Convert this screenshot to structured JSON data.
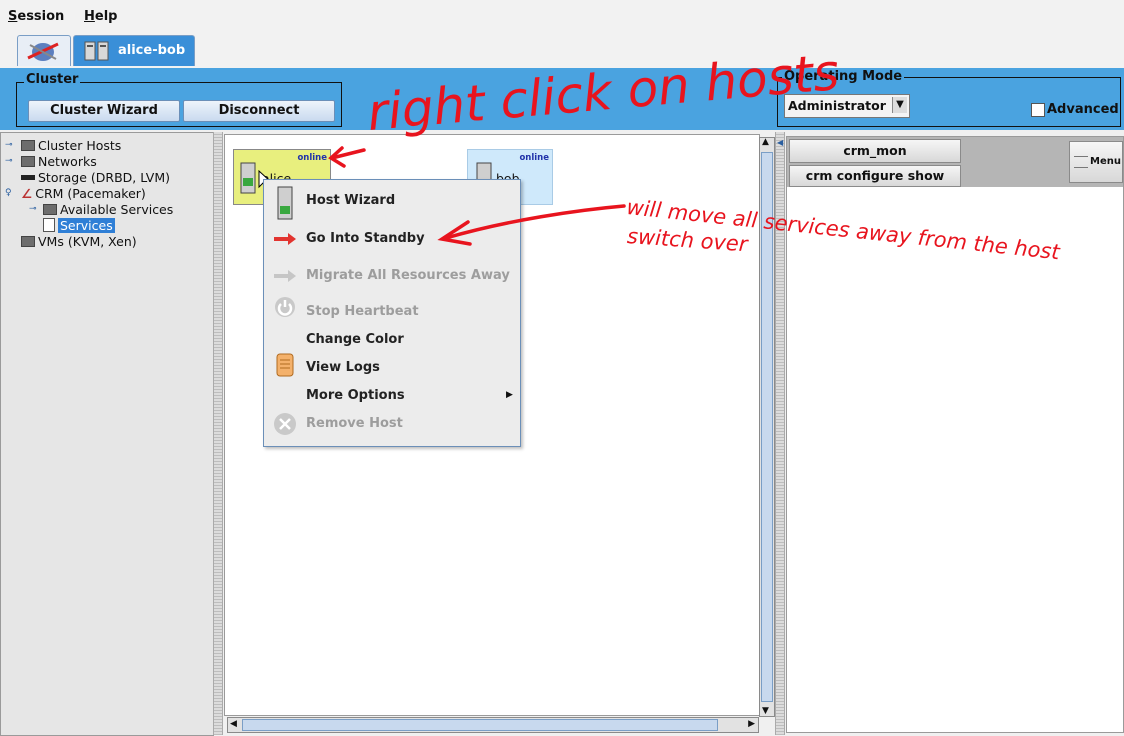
{
  "menubar": {
    "items": [
      "Session",
      "Help"
    ]
  },
  "tabs": [
    {
      "icon": "cluster-logo-icon",
      "label": ""
    },
    {
      "icon": "server-pair-icon",
      "label": "alice-bob"
    }
  ],
  "cluster_group": {
    "title": "Cluster",
    "wizard_label": "Cluster Wizard",
    "disconnect_label": "Disconnect"
  },
  "operating_mode": {
    "title": "Operating Mode",
    "selected": "Administrator",
    "advanced_label": "Advanced",
    "advanced_checked": false
  },
  "tree": {
    "items": [
      {
        "label": "Cluster Hosts"
      },
      {
        "label": "Networks"
      },
      {
        "label": "Storage (DRBD, LVM)"
      },
      {
        "label": "CRM (Pacemaker)"
      },
      {
        "label": "Available Services"
      },
      {
        "label": "Services",
        "selected": true
      },
      {
        "label": "VMs (KVM, Xen)"
      }
    ]
  },
  "hosts": [
    {
      "name": "alice",
      "status": "online",
      "color": "#e8ef7e"
    },
    {
      "name": "bob",
      "status": "online",
      "color": "#cfe9fb"
    }
  ],
  "context_menu": {
    "items": [
      {
        "label": "Host Wizard",
        "enabled": true,
        "icon": "server-icon"
      },
      {
        "label": "Go Into Standby",
        "enabled": true,
        "icon": "arrow-right-icon"
      },
      {
        "label": "Migrate All Resources Away",
        "enabled": false,
        "icon": "arrow-right-icon"
      },
      {
        "label": "Stop Heartbeat",
        "enabled": false,
        "icon": "power-icon"
      },
      {
        "label": "Change Color",
        "enabled": true,
        "icon": ""
      },
      {
        "label": "View Logs",
        "enabled": true,
        "icon": "scroll-icon"
      },
      {
        "label": "More Options",
        "enabled": true,
        "icon": "",
        "submenu": true
      },
      {
        "label": "Remove Host",
        "enabled": false,
        "icon": "remove-icon"
      }
    ]
  },
  "right_panel": {
    "crm_mon_label": "crm_mon",
    "crm_configure_label": "crm configure show",
    "menu_label": "Menu"
  },
  "annotations": {
    "right_click": "right click on hosts",
    "will_move": "will move all services away from the host",
    "switch_over": "switch over"
  },
  "colors": {
    "toolbar_blue": "#4aa3e0",
    "annotation_red": "#e8141e",
    "tab_blue": "#3a8fd8"
  }
}
